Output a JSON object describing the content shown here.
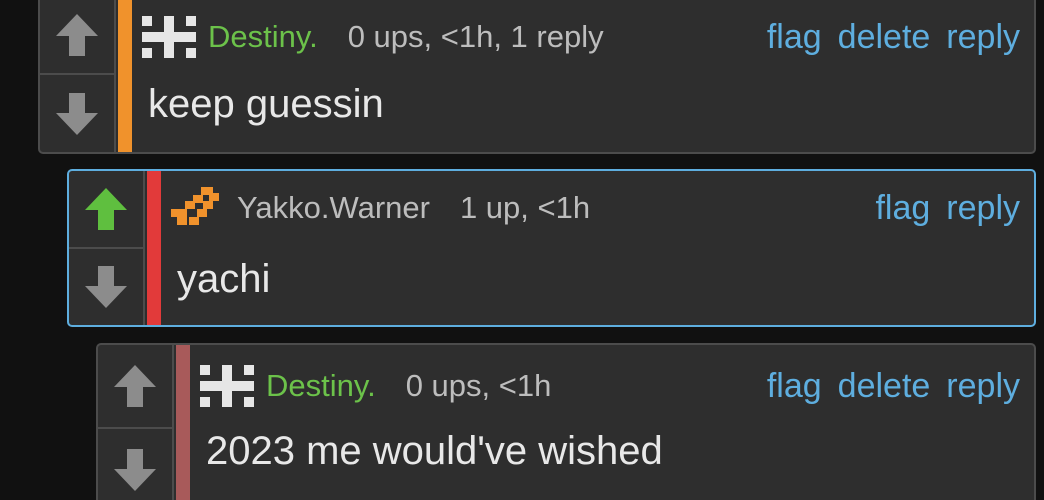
{
  "colors": {
    "accent_link": "#5eaedf",
    "username_green": "#6cc24a",
    "username_gray": "#bdbdbd",
    "stripe_orange": "#f0922c",
    "stripe_red": "#e23a3a",
    "stripe_mauve": "#a85a5a",
    "upvote_active": "#5fbf3f",
    "vote_inactive": "#8c8c8c"
  },
  "comments": [
    {
      "author": "Destiny.",
      "meta": "0 ups, <1h, 1 reply",
      "text": "keep guessin",
      "actions": [
        "flag",
        "delete",
        "reply"
      ],
      "upvoted": false,
      "selected": false
    },
    {
      "author": "Yakko.Warner",
      "meta": "1 up, <1h",
      "text": "yachi",
      "actions": [
        "flag",
        "reply"
      ],
      "upvoted": true,
      "selected": true
    },
    {
      "author": "Destiny.",
      "meta": "0 ups, <1h",
      "text": "2023 me would've wished",
      "actions": [
        "flag",
        "delete",
        "reply"
      ],
      "upvoted": false,
      "selected": false
    }
  ]
}
